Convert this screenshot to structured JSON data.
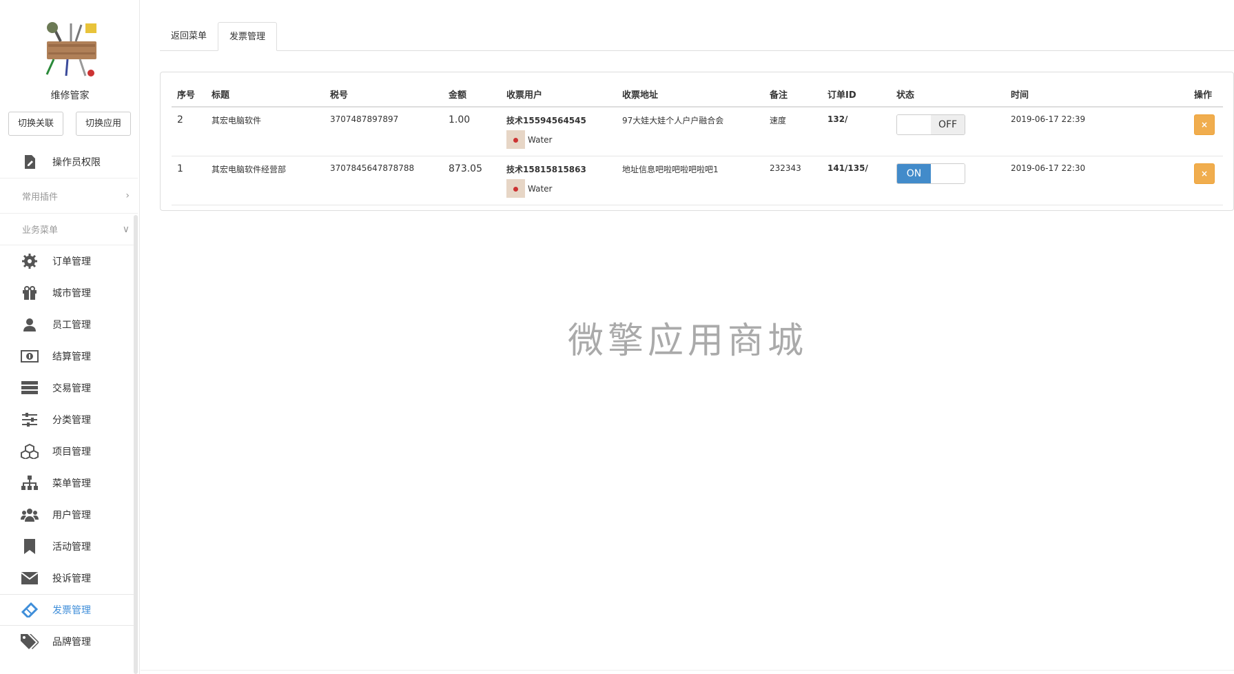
{
  "sidebar": {
    "app_name": "维修管家",
    "switch_left": "切换关联",
    "switch_right": "切换应用",
    "top_items": [
      {
        "label": "操作员权限",
        "icon": "document-edit-icon"
      }
    ],
    "groups": [
      {
        "label": "常用插件",
        "chevron": "chevron-right-icon"
      },
      {
        "label": "业务菜单",
        "chevron": "chevron-down-icon"
      }
    ],
    "items": [
      {
        "label": "订单管理",
        "icon": "gear-icon"
      },
      {
        "label": "城市管理",
        "icon": "gift-icon"
      },
      {
        "label": "员工管理",
        "icon": "user-icon"
      },
      {
        "label": "结算管理",
        "icon": "money-icon"
      },
      {
        "label": "交易管理",
        "icon": "server-icon"
      },
      {
        "label": "分类管理",
        "icon": "sliders-icon"
      },
      {
        "label": "项目管理",
        "icon": "cubes-icon"
      },
      {
        "label": "菜单管理",
        "icon": "sitemap-icon"
      },
      {
        "label": "用户管理",
        "icon": "users-icon"
      },
      {
        "label": "活动管理",
        "icon": "bookmark-icon"
      },
      {
        "label": "投诉管理",
        "icon": "envelope-icon"
      },
      {
        "label": "发票管理",
        "icon": "ticket-icon",
        "active": true
      },
      {
        "label": "品牌管理",
        "icon": "tags-icon"
      }
    ]
  },
  "tabs": [
    {
      "label": "返回菜单",
      "active": false
    },
    {
      "label": "发票管理",
      "active": true
    }
  ],
  "table": {
    "headers": [
      "序号",
      "标题",
      "税号",
      "金额",
      "收票用户",
      "收票地址",
      "备注",
      "订单ID",
      "状态",
      "时间",
      "操作"
    ],
    "rows": [
      {
        "id": "2",
        "title": "其宏电脑软件",
        "tax": "3707487897897",
        "amount": "1.00",
        "user": "技术15594564545",
        "nick": "Water",
        "address": "97大娃大娃个人户户融合会",
        "remark": "速度",
        "order": "132/",
        "status": "OFF",
        "time": "2019-06-17 22:39"
      },
      {
        "id": "1",
        "title": "其宏电脑软件经营部",
        "tax": "3707845647878788",
        "amount": "873.05",
        "user": "技术15815815863",
        "nick": "Water",
        "address": "地址信息吧啦吧啦吧啦吧1",
        "remark": "232343",
        "order": "141/135/",
        "status": "ON",
        "time": "2019-06-17 22:30"
      }
    ],
    "delete_label": "×"
  },
  "watermark": "微擎应用商城",
  "colors": {
    "accent": "#3f8ed9",
    "toggle_on": "#428bca",
    "delete": "#f0ad4e"
  }
}
